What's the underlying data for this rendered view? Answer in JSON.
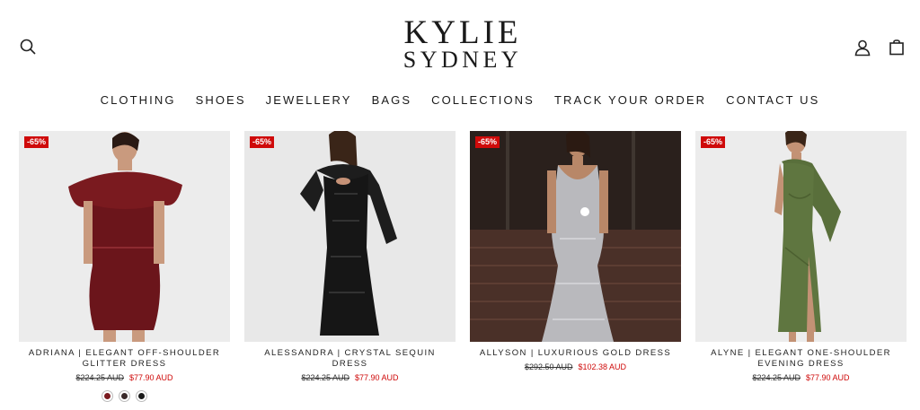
{
  "header": {
    "logo_line1": "KYLIE",
    "logo_line2": "SYDNEY",
    "icons": [
      "search-icon",
      "account-icon",
      "cart-icon"
    ]
  },
  "nav": [
    "CLOTHING",
    "SHOES",
    "JEWELLERY",
    "BAGS",
    "COLLECTIONS",
    "TRACK YOUR ORDER",
    "CONTACT US"
  ],
  "products": [
    {
      "badge": "-65%",
      "title": "ADRIANA | ELEGANT OFF-SHOULDER GLITTER DRESS",
      "old_price": "$224.25 AUD",
      "new_price": "$77.90 AUD",
      "swatches": [
        "#7a1a1f",
        "#3a2a2a",
        "#1a1a1a"
      ]
    },
    {
      "badge": "-65%",
      "title": "ALESSANDRA | CRYSTAL SEQUIN DRESS",
      "old_price": "$224.25 AUD",
      "new_price": "$77.90 AUD"
    },
    {
      "badge": "-65%",
      "title": "ALLYSON | LUXURIOUS GOLD DRESS",
      "old_price": "$292.50 AUD",
      "new_price": "$102.38 AUD"
    },
    {
      "badge": "-65%",
      "title": "ALYNE | ELEGANT ONE-SHOULDER EVENING DRESS",
      "old_price": "$224.25 AUD",
      "new_price": "$77.90 AUD"
    }
  ],
  "colors": {
    "sale_red": "#cf0a0a",
    "text": "#1a1a1a"
  }
}
